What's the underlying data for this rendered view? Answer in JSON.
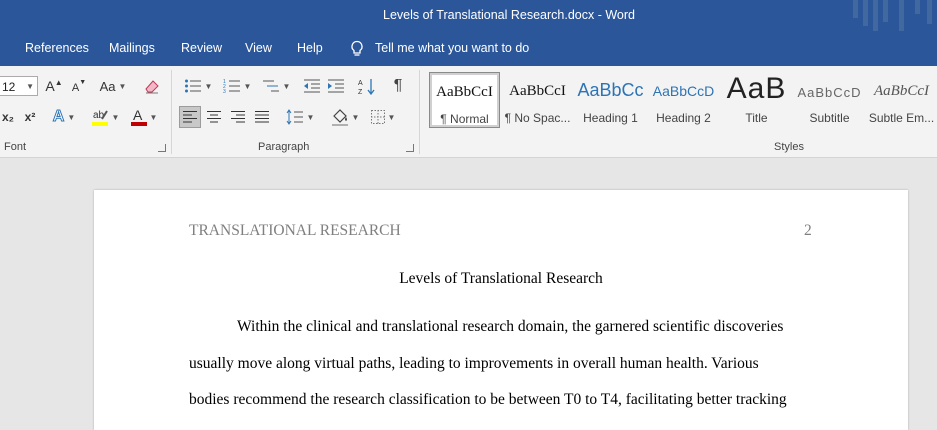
{
  "window": {
    "title": "Levels of Translational Research.docx  -  Word"
  },
  "tabs": {
    "items": [
      "References",
      "Mailings",
      "Review",
      "View",
      "Help"
    ],
    "tell_me": "Tell me what you want to do"
  },
  "font_group": {
    "size": "12",
    "grow": "A",
    "shrink": "A",
    "change_case": "Aa",
    "subscript": "x₂",
    "superscript": "x²",
    "label": "Font",
    "highlight_color": "#ffff00",
    "font_color": "#c00000"
  },
  "paragraph_group": {
    "label": "Paragraph",
    "show_marks": "¶"
  },
  "styles_group": {
    "label": "Styles",
    "items": [
      {
        "preview": "AaBbCcI",
        "name": "¶ Normal",
        "selected": true
      },
      {
        "preview": "AaBbCcI",
        "name": "¶ No Spac..."
      },
      {
        "preview": "AaBbCc",
        "name": "Heading 1"
      },
      {
        "preview": "AaBbCcD",
        "name": "Heading 2"
      },
      {
        "preview": "AaB",
        "name": "Title"
      },
      {
        "preview": "AaBbCcD",
        "name": "Subtitle"
      },
      {
        "preview": "AaBbCcI",
        "name": "Subtle Em..."
      }
    ]
  },
  "document": {
    "running_head": "TRANSLATIONAL RESEARCH",
    "page_number": "2",
    "heading": "Levels of Translational Research",
    "lines": [
      "Within the clinical and translational research domain, the garnered scientific discoveries",
      "usually move along virtual paths, leading to improvements in overall human health. Various",
      "bodies recommend the research classification to be between T0 to T4, facilitating better tracking"
    ]
  }
}
